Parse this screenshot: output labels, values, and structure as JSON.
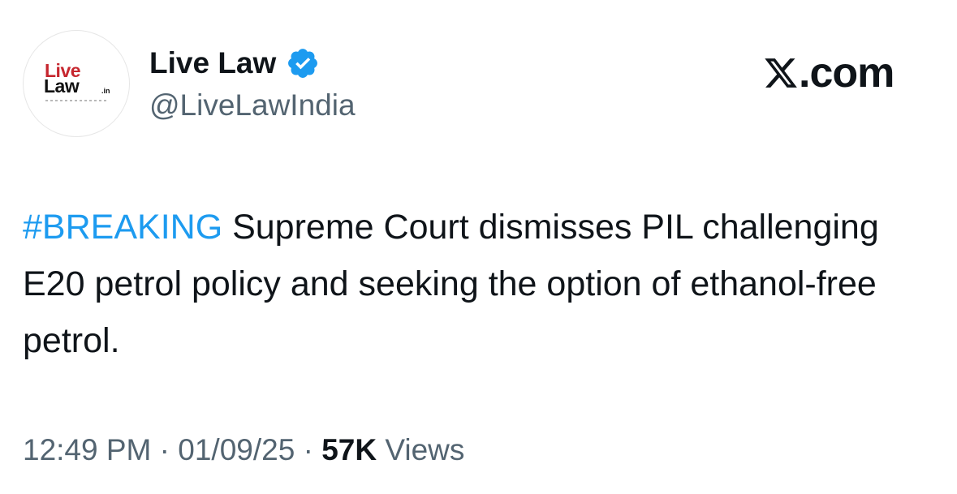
{
  "author": {
    "display_name": "Live Law",
    "handle": "@LiveLawIndia",
    "verified": true,
    "avatar_logo_line1": "Live",
    "avatar_logo_line2": "Law",
    "avatar_logo_suffix": ".in"
  },
  "brand": {
    "icon": "x-logo-icon",
    "rest_text": ".com"
  },
  "tweet": {
    "hashtag": "#BREAKING",
    "body": " Supreme Court dismisses PIL challenging E20 petrol policy and seeking the option of ethanol-free petrol."
  },
  "meta": {
    "time": "12:49 PM",
    "separator": "·",
    "date": "01/09/25",
    "views_count": "57K",
    "views_label": "Views"
  },
  "colors": {
    "accent": "#1d9bf0",
    "text": "#0f1419",
    "secondary": "#536471",
    "logo_red": "#c6262e"
  }
}
